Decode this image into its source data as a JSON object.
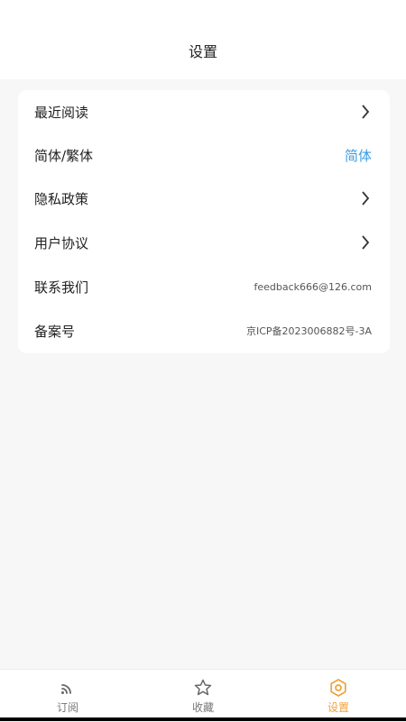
{
  "header": {
    "title": "设置"
  },
  "settings": {
    "items": [
      {
        "label": "最近阅读"
      },
      {
        "label": "简体/繁体",
        "value": "简体"
      },
      {
        "label": "隐私政策"
      },
      {
        "label": "用户协议"
      },
      {
        "label": "联系我们",
        "value": "feedback666@126.com"
      },
      {
        "label": "备案号",
        "value": "京ICP备2023006882号-3A"
      }
    ]
  },
  "tabbar": {
    "tabs": [
      {
        "label": "订阅",
        "icon": "rss-icon"
      },
      {
        "label": "收藏",
        "icon": "star-icon"
      },
      {
        "label": "设置",
        "icon": "hexagon-settings-icon",
        "active": true
      }
    ]
  },
  "colors": {
    "accent": "#f0a23a",
    "link": "#3a9de3"
  }
}
